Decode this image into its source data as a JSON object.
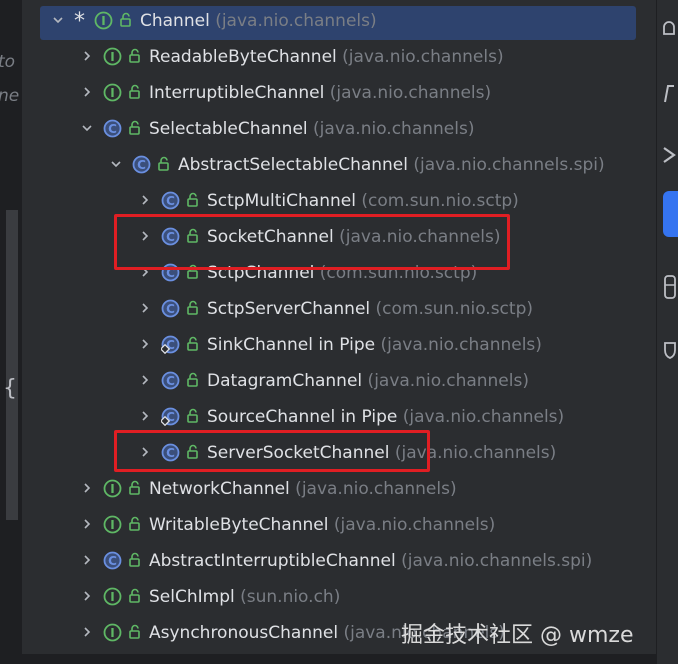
{
  "left_gutter": {
    "frag1": "to",
    "frag2": "ne",
    "brace": "{"
  },
  "tree": {
    "rows": [
      {
        "name": "Channel",
        "pkg": "(java.nio.channels)",
        "kind": "interface",
        "expanded": true,
        "selected": true,
        "starred": true
      },
      {
        "name": "ReadableByteChannel",
        "pkg": "(java.nio.channels)",
        "kind": "interface",
        "expanded": false
      },
      {
        "name": "InterruptibleChannel",
        "pkg": "(java.nio.channels)",
        "kind": "interface",
        "expanded": false
      },
      {
        "name": "SelectableChannel",
        "pkg": "(java.nio.channels)",
        "kind": "abstract-class",
        "expanded": true
      },
      {
        "name": "AbstractSelectableChannel",
        "pkg": "(java.nio.channels.spi)",
        "kind": "abstract-class",
        "expanded": true
      },
      {
        "name": "SctpMultiChannel",
        "pkg": "(com.sun.nio.sctp)",
        "kind": "abstract-class",
        "expanded": false
      },
      {
        "name": "SocketChannel",
        "pkg": "(java.nio.channels)",
        "kind": "abstract-class",
        "expanded": false,
        "highlighted": true
      },
      {
        "name": "SctpChannel",
        "pkg": "(com.sun.nio.sctp)",
        "kind": "abstract-class",
        "expanded": false
      },
      {
        "name": "SctpServerChannel",
        "pkg": "(com.sun.nio.sctp)",
        "kind": "abstract-class",
        "expanded": false
      },
      {
        "name": "SinkChannel in Pipe",
        "pkg": "(java.nio.channels)",
        "kind": "static-nested-class",
        "expanded": false
      },
      {
        "name": "DatagramChannel",
        "pkg": "(java.nio.channels)",
        "kind": "abstract-class",
        "expanded": false
      },
      {
        "name": "SourceChannel in Pipe",
        "pkg": "(java.nio.channels)",
        "kind": "static-nested-class",
        "expanded": false
      },
      {
        "name": "ServerSocketChannel",
        "pkg": "(java.nio.channels)",
        "kind": "abstract-class",
        "expanded": false,
        "highlighted": true
      },
      {
        "name": "NetworkChannel",
        "pkg": "(java.nio.channels)",
        "kind": "interface",
        "expanded": false
      },
      {
        "name": "WritableByteChannel",
        "pkg": "(java.nio.channels)",
        "kind": "interface",
        "expanded": false
      },
      {
        "name": "AbstractInterruptibleChannel",
        "pkg": "(java.nio.channels.spi)",
        "kind": "abstract-class",
        "expanded": false
      },
      {
        "name": "SelChImpl",
        "pkg": "(sun.nio.ch)",
        "kind": "interface",
        "expanded": false
      },
      {
        "name": "AsynchronousChannel",
        "pkg": "(java.nio.channels)",
        "kind": "interface",
        "expanded": false
      }
    ]
  },
  "right_panel": {
    "icons": [
      "notifications-icon",
      "m-icon",
      "ai-assistant-icon",
      "active-tool-icon",
      "database-icon",
      "shield-icon"
    ]
  },
  "watermark": "掘金技术社区 @ wmze",
  "colors": {
    "interface_icon": "#5fb865",
    "class_icon": "#6a8fe0",
    "lock_icon": "#5fb865",
    "highlight_box": "#e01e23",
    "selection": "#2e436e"
  }
}
